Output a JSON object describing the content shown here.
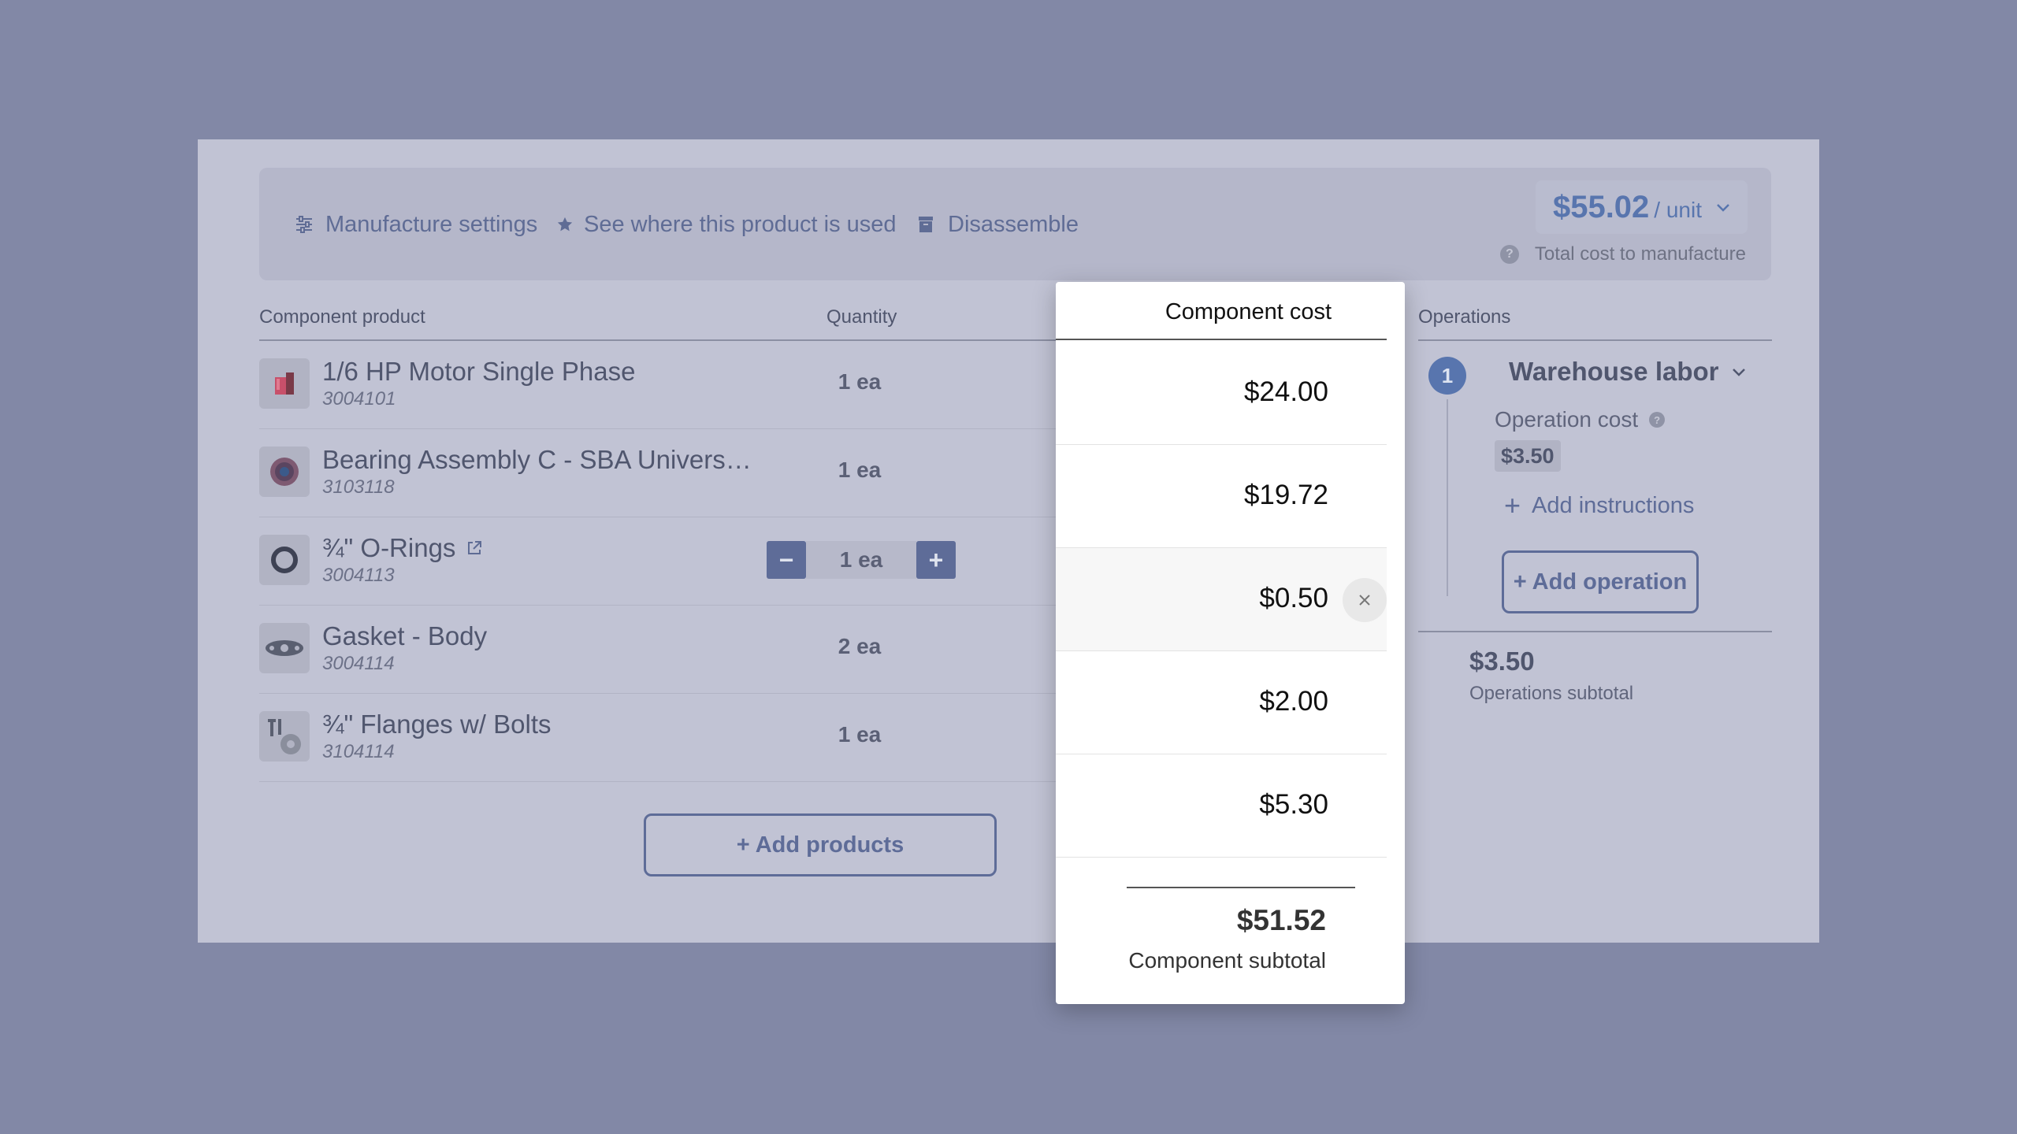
{
  "toolbar": {
    "manufacture_settings": "Manufacture settings",
    "see_where_used": "See where this product is used",
    "disassemble": "Disassemble",
    "price": "$55.02",
    "price_unit": "/ unit",
    "price_caption": "Total cost to manufacture"
  },
  "columns": {
    "component": "Component product",
    "quantity": "Quantity",
    "operations": "Operations"
  },
  "rows": [
    {
      "name": "1/6 HP Motor Single Phase",
      "sku": "3004101",
      "qty": "1 ea",
      "cost": "$24.00"
    },
    {
      "name": "Bearing Assembly C - SBA Univers…",
      "sku": "3103118",
      "qty": "1 ea",
      "cost": "$19.72"
    },
    {
      "name": "¾\" O-Rings",
      "sku": "3004113",
      "qty": "1 ea",
      "cost": "$0.50"
    },
    {
      "name": "Gasket - Body",
      "sku": "3004114",
      "qty": "2 ea",
      "cost": "$2.00"
    },
    {
      "name": "¾\" Flanges w/ Bolts",
      "sku": "3104114",
      "qty": "1 ea",
      "cost": "$5.30"
    }
  ],
  "add_products": "+ Add products",
  "operations": {
    "step_number": "1",
    "name": "Warehouse labor",
    "cost_label": "Operation cost",
    "cost_value": "$3.50",
    "add_instructions": "Add instructions",
    "add_operation": "+ Add operation",
    "subtotal_value": "$3.50",
    "subtotal_label": "Operations subtotal"
  },
  "popup": {
    "title": "Component cost",
    "subtotal_value": "$51.52",
    "subtotal_label": "Component subtotal"
  },
  "icons": {
    "settings": "sliders-icon",
    "star": "star-icon",
    "disassemble": "box-icon",
    "external": "external-link-icon",
    "remove": "close-icon",
    "chevron": "chevron-down-icon"
  },
  "colors": {
    "accent": "#5875ae",
    "button": "#5e6c98",
    "overlay_bg": "#8288a6"
  }
}
